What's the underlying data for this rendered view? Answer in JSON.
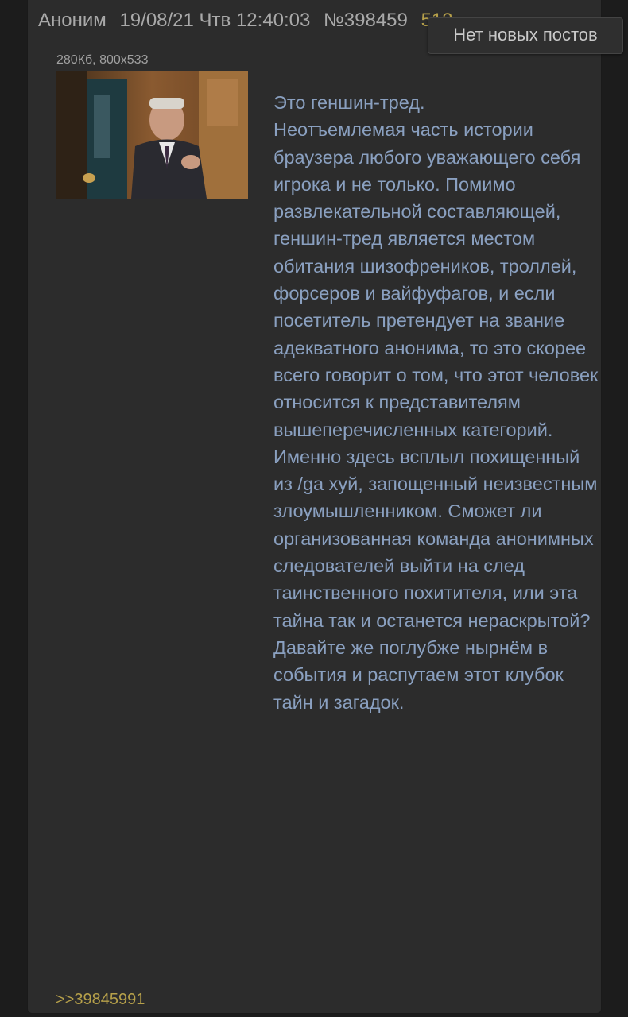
{
  "post": {
    "author": "Аноним",
    "date": "19/08/21 Чтв 12:40:03",
    "number": "№398459",
    "count": "513",
    "file_info": "280Кб, 800x533",
    "body": "Это геншин-тред.\nНеотъемлемая часть истории браузера любого уважающего себя игрока и не только. Помимо развлекательной составляющей, геншин-тред является местом обитания шизофреников, троллей, форсеров и вайфуфагов, и если посетитель претендует на звание адекватного анонима, то это скорее всего говорит о том, что этот человек относится к представителям вышеперечисленных категорий.\nИменно здесь всплыл похищенный из /ga хуй, запощенный неизвестным злоумышленником. Сможет ли организованная команда анонимных следователей выйти на след таинственного похитителя, или эта тайна так и останется нераскрытой? Давайте же поглубже нырнём в события и распутаем этот клубок тайн и загадок.",
    "reply_link": ">>39845991"
  },
  "toast": "Нет новых постов",
  "icons": {
    "thumbnail": "post-image-thumbnail"
  }
}
